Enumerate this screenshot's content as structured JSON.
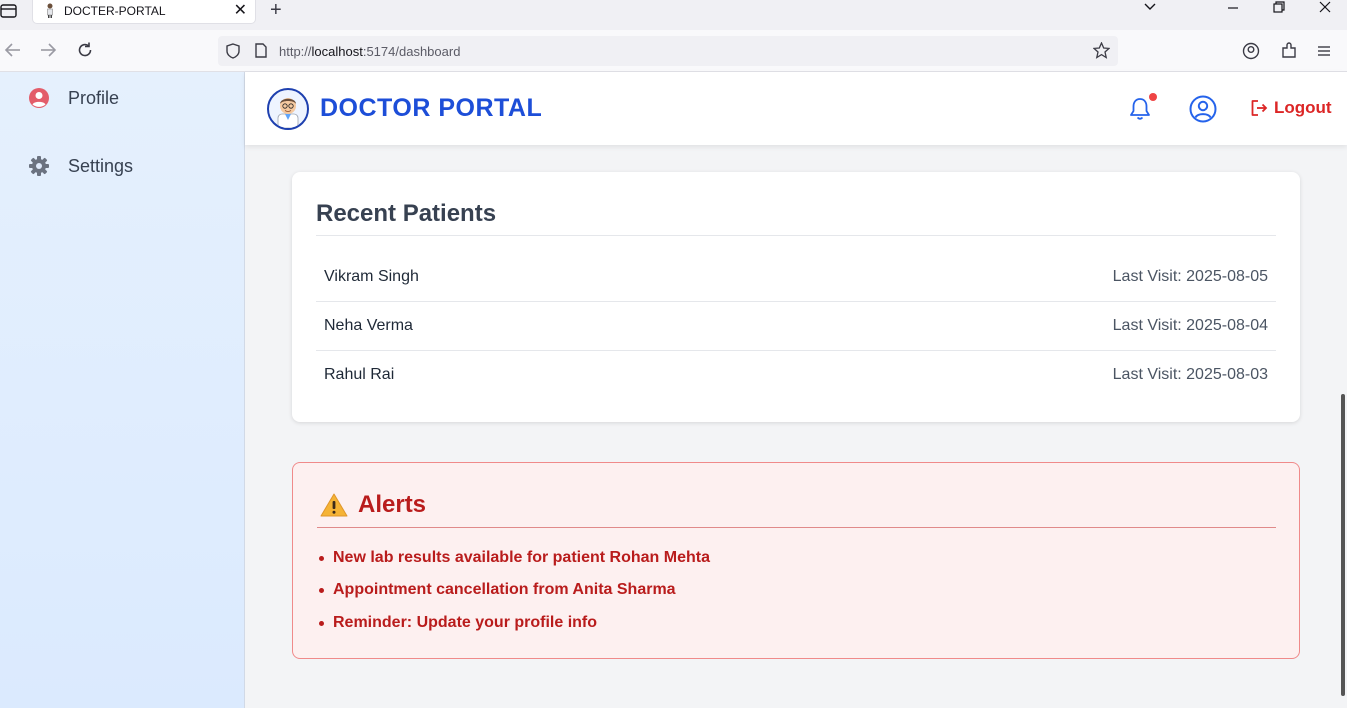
{
  "browser": {
    "tab_title": "DOCTER-PORTAL",
    "url_prefix": "http://",
    "url_host": "localhost",
    "url_rest": ":5174/dashboard"
  },
  "sidebar": {
    "items": [
      {
        "label": "Profile",
        "icon": "user-circle-icon"
      },
      {
        "label": "Settings",
        "icon": "gear-icon"
      }
    ]
  },
  "header": {
    "brand": "DOCTOR PORTAL",
    "logout_label": "Logout",
    "has_notification": true
  },
  "recent_patients": {
    "title": "Recent Patients",
    "rows": [
      {
        "name": "Vikram Singh",
        "last_visit": "Last Visit: 2025-08-05"
      },
      {
        "name": "Neha Verma",
        "last_visit": "Last Visit: 2025-08-04"
      },
      {
        "name": "Rahul Rai",
        "last_visit": "Last Visit: 2025-08-03"
      }
    ]
  },
  "alerts": {
    "title": "Alerts",
    "items": [
      "New lab results available for patient Rohan Mehta",
      "Appointment cancellation from Anita Sharma",
      "Reminder: Update your profile info"
    ]
  },
  "colors": {
    "brand": "#1d4ed8",
    "danger": "#dc2626",
    "alert_text": "#b91c1c"
  }
}
